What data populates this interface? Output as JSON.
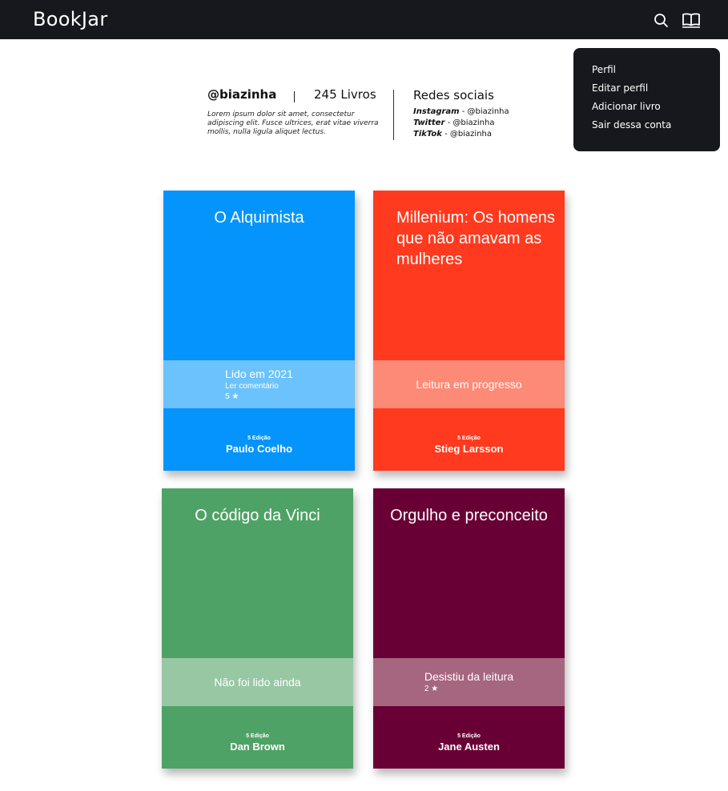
{
  "navbar": {
    "brand": "BookJar",
    "icons": [
      "search-icon",
      "open-book-icon"
    ]
  },
  "menu": {
    "items": [
      "Perfil",
      "Editar perfil",
      "Adicionar livro",
      "Sair dessa conta"
    ]
  },
  "profile": {
    "username": "@biazinha",
    "book_count": "245 Livros",
    "bio": "Lorem ipsum dolor sit amet, consectetur adipiscing elit. Fusce ultrices, erat vitae viverra mollis, nulla ligula aliquet lectus.",
    "social_title": "Redes sociais",
    "social": [
      {
        "network": "Instagram",
        "sep": " - ",
        "handle": "@biazinha"
      },
      {
        "network": "Twitter",
        "sep": " - ",
        "handle": "@biazinha"
      },
      {
        "network": "TikTok",
        "sep": " - ",
        "handle": "@biazinha"
      }
    ]
  },
  "books": [
    {
      "title": "O Alquimista",
      "status": "Lido em 2021",
      "sub": "Ler comentário",
      "stars": "5 ★",
      "edition": "5 Edição",
      "author": "Paulo Coelho",
      "color": "#0594fb",
      "band_color": "#6bc2fd"
    },
    {
      "title": "Millenium: Os homens que não amavam as mulheres",
      "status": "Leitura em progresso",
      "sub": "",
      "stars": "",
      "edition": "5 Edição",
      "author": "Stieg Larsson",
      "color": "#ff3a1f",
      "band_color": "#fd8a77"
    },
    {
      "title": "O código da Vinci",
      "status": "Não foi lido ainda",
      "sub": "",
      "stars": "",
      "edition": "5 Edição",
      "author": "Dan Brown",
      "color": "#4fa266",
      "band_color": "#98c7a4"
    },
    {
      "title": "Orgulho e preconceito",
      "status": "Desistiu da leitura",
      "sub": "",
      "stars": "2 ★",
      "edition": "5 Edição",
      "author": "Jane Austen",
      "color": "#690035",
      "band_color": "#a6667f"
    }
  ]
}
